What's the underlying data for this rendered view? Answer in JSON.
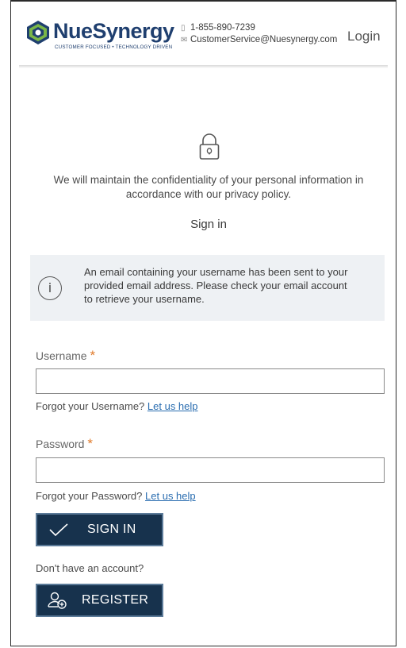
{
  "header": {
    "brand": "NueSynergy",
    "tagline": "CUSTOMER FOCUSED • TECHNOLOGY DRIVEN",
    "phone": "1-855-890-7239",
    "email": "CustomerService@Nuesynergy.com",
    "login_label": "Login"
  },
  "main": {
    "privacy_text": "We will maintain the confidentiality of your personal information in accordance with our privacy policy.",
    "title": "Sign in",
    "notice": "An email containing your username has been sent to your provided email address. Please check your email account to retrieve your username.",
    "username_label": "Username",
    "username_value": "",
    "forgot_username_text": "Forgot your Username?",
    "forgot_username_link": "Let us help",
    "password_label": "Password",
    "password_value": "",
    "forgot_password_text": "Forgot your Password?",
    "forgot_password_link": "Let us help",
    "required_marker": "*",
    "signin_button": "SIGN IN",
    "no_account_text": "Don't have an account?",
    "register_button": "REGISTER"
  },
  "colors": {
    "brand_navy": "#1f3f6f",
    "button_bg": "#17324d",
    "required": "#e07a2a",
    "link": "#2a6db0",
    "notice_bg": "#eef1f4"
  },
  "icons": [
    "logo-icon",
    "phone-icon",
    "mail-icon",
    "lock-icon",
    "info-icon",
    "check-icon",
    "add-user-icon"
  ]
}
